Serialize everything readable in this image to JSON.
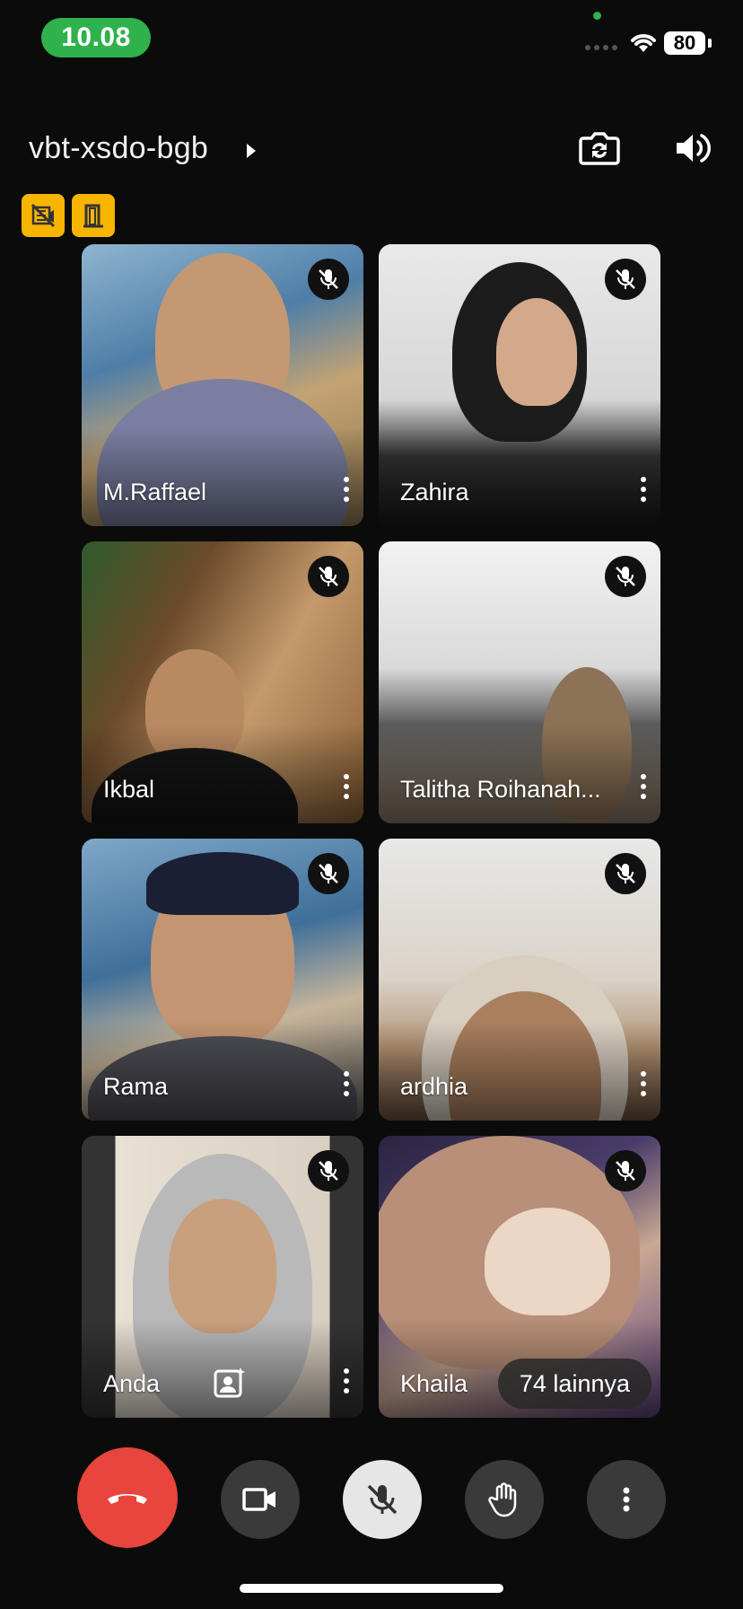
{
  "status_bar": {
    "time": "10.08",
    "battery": "80"
  },
  "header": {
    "meeting_code": "vbt-xsdo-bgb"
  },
  "badges": [
    {
      "icon": "no-recording-icon"
    },
    {
      "icon": "door-icon"
    }
  ],
  "participants": [
    {
      "name": "M.Raffael",
      "muted": true
    },
    {
      "name": "Zahira",
      "muted": true
    },
    {
      "name": "Ikbal",
      "muted": true
    },
    {
      "name": "Talitha Roihanah...",
      "muted": true
    },
    {
      "name": "Rama",
      "muted": true
    },
    {
      "name": "ardhia",
      "muted": true
    },
    {
      "name": "Anda",
      "muted": true
    },
    {
      "name": "Khaila",
      "muted": true
    }
  ],
  "others_count_label": "74 lainnya",
  "controls": {
    "end_call": "end-call-icon",
    "camera": "video-camera-icon",
    "mic": "mic-off-icon",
    "raise_hand": "hand-icon",
    "more": "more-vert-icon"
  },
  "colors": {
    "status_green": "#2fb24c",
    "badge_yellow": "#f7b500",
    "end_call_red": "#e8453c",
    "background": "#0b0b0b"
  }
}
